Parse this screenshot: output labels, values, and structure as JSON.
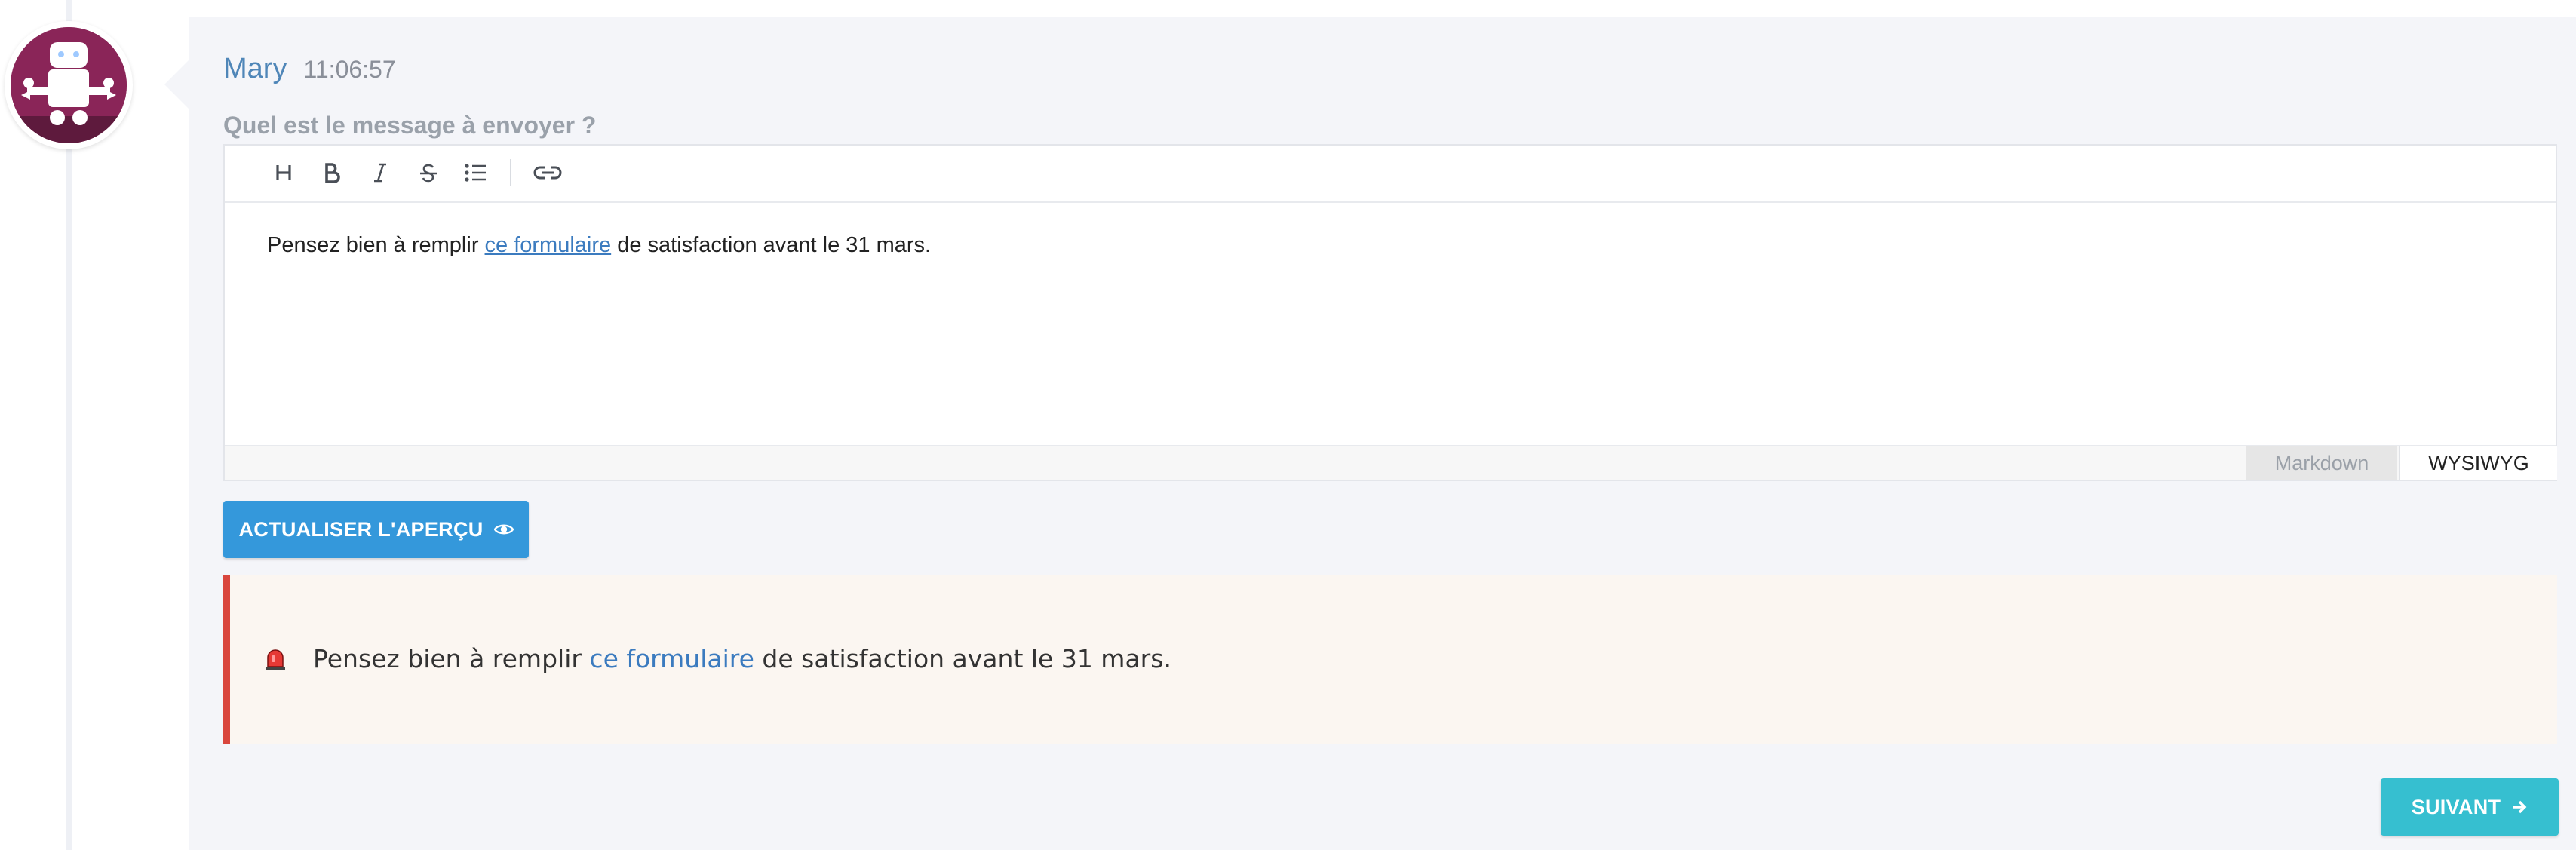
{
  "message": {
    "author": "Mary",
    "time": "11:06:57",
    "question": "Quel est le message à envoyer ?"
  },
  "editor": {
    "toolbar": {
      "heading_icon": "heading-icon",
      "bold_icon": "bold-icon",
      "italic_icon": "italic-icon",
      "strikethrough_icon": "strikethrough-icon",
      "list_icon": "bullet-list-icon",
      "link_icon": "link-icon"
    },
    "content": {
      "before_link": "Pensez bien à remplir ",
      "link_text": "ce formulaire",
      "after_link": " de satisfaction avant le 31 mars."
    },
    "modes": {
      "markdown": "Markdown",
      "wysiwyg": "WYSIWYG",
      "active": "WYSIWYG"
    }
  },
  "actions": {
    "preview_label": "ACTUALISER L'APERÇU",
    "preview_icon": "eye-icon",
    "next_label": "SUIVANT",
    "next_icon": "arrow-right-icon"
  },
  "preview": {
    "icon": "siren-icon",
    "before_link": "Pensez bien à remplir ",
    "link_text": "ce formulaire",
    "after_link": " de satisfaction avant le 31 mars.",
    "border_color": "#d9463d"
  },
  "colors": {
    "author": "#4f86b8",
    "primary_button": "#3498db",
    "next_button": "#36bfd0",
    "avatar_bg": "#8a2558"
  }
}
